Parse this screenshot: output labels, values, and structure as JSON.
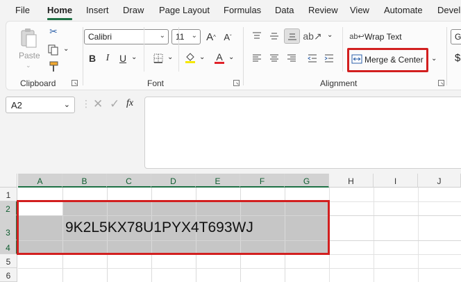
{
  "menu": {
    "tabs": [
      "File",
      "Home",
      "Insert",
      "Draw",
      "Page Layout",
      "Formulas",
      "Data",
      "Review",
      "View",
      "Automate",
      "Devel"
    ],
    "active": "Home"
  },
  "clipboard": {
    "paste_label": "Paste",
    "group_label": "Clipboard"
  },
  "font": {
    "name": "Calibri",
    "size": "11",
    "group_label": "Font",
    "bold": "B",
    "grow": "A",
    "shrink": "A",
    "font_color_letter": "A"
  },
  "alignment": {
    "wrap_text": "Wrap Text",
    "merge_center": "Merge & Center",
    "group_label": "Alignment"
  },
  "number": {
    "format": "Ge",
    "currency": "$"
  },
  "formula_bar": {
    "name_box": "A2",
    "fx": "fx",
    "value": ""
  },
  "grid": {
    "columns": [
      "A",
      "B",
      "C",
      "D",
      "E",
      "F",
      "G",
      "H",
      "I",
      "J"
    ],
    "rows": [
      "1",
      "2",
      "3",
      "4",
      "5",
      "6"
    ],
    "merged_value": "9K2L5KX78U1PYX4T693WJ"
  },
  "colors": {
    "accent": "#1e7145",
    "highlight_box": "#d21f1f",
    "selection": "#c6c6c6"
  }
}
